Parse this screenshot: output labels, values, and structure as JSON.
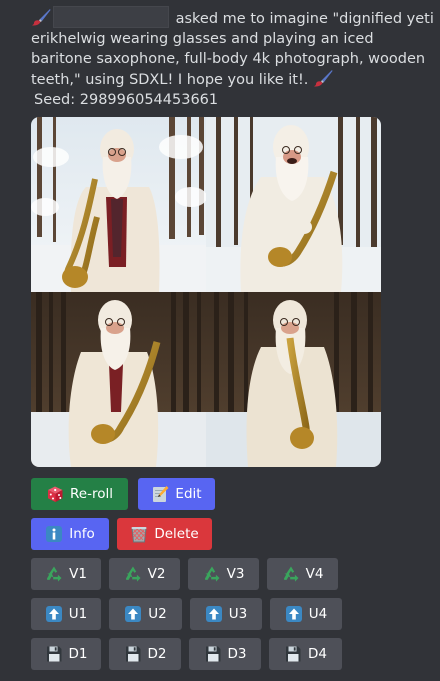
{
  "message": {
    "text": "asked me to imagine \"dignified yeti erikhelwig wearing glasses and playing an iced baritone saxophone, full-body 4k photograph, wooden teeth,\" using SDXL! I hope you like it!.",
    "seed": "Seed: 298996054453661"
  },
  "image_grid": {
    "tiles": [
      "image-1",
      "image-2",
      "image-3",
      "image-4"
    ]
  },
  "buttons": {
    "reroll": "Re-roll",
    "edit": "Edit",
    "info": "Info",
    "delete": "Delete",
    "variations": [
      "V1",
      "V2",
      "V3",
      "V4"
    ],
    "upscales": [
      "U1",
      "U2",
      "U3",
      "U4"
    ],
    "downloads": [
      "D1",
      "D2",
      "D3",
      "D4"
    ]
  },
  "colors": {
    "background": "#313338",
    "text": "#dbdee1",
    "gray_button": "#4e5058",
    "green_button": "#248046",
    "blurple_button": "#5865f2",
    "red_button": "#da373c"
  },
  "icons": {
    "reroll": "dice-icon",
    "edit": "memo-icon",
    "info": "info-icon",
    "delete": "wastebasket-icon",
    "variation": "recycle-icon",
    "upscale": "up-arrow-icon",
    "download": "floppy-disk-icon",
    "message_decoration": "paintbrush-icon"
  }
}
